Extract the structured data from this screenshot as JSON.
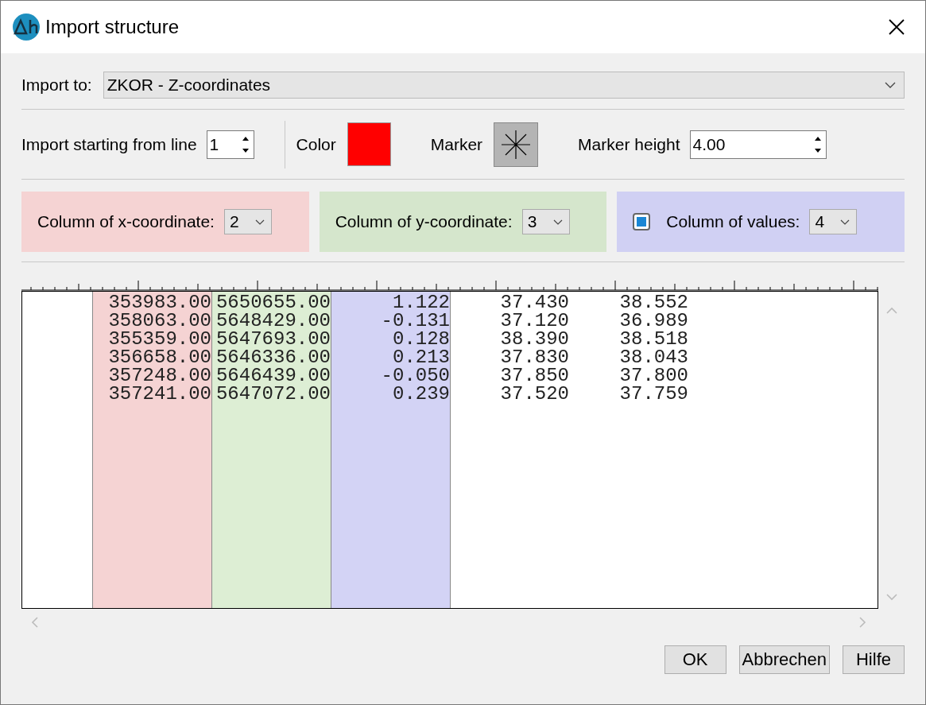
{
  "window": {
    "title": "Import structure"
  },
  "import_to": {
    "label": "Import to:",
    "value": "ZKOR - Z-coordinates"
  },
  "start_line": {
    "label": "Import starting from line",
    "value": "1"
  },
  "color": {
    "label": "Color",
    "color": "#ff0000"
  },
  "marker": {
    "label": "Marker"
  },
  "marker_height": {
    "label": "Marker height",
    "value": "4.00"
  },
  "column_selectors": [
    {
      "kind": "plain",
      "label": "Column of x-coordinate:",
      "value": "2",
      "color": "#f5d3d3"
    },
    {
      "kind": "plain",
      "label": "Column of y-coordinate:",
      "value": "3",
      "color": "#d5e6cc"
    },
    {
      "kind": "checkbox",
      "label": "Column of values:",
      "value": "4",
      "checked": true,
      "color": "#d0d0f3"
    }
  ],
  "preview": {
    "columns": [
      {
        "color": "#f5d3d3",
        "cells": [
          "353983.00",
          "358063.00",
          "355359.00",
          "356658.00",
          "357248.00",
          "357241.00"
        ]
      },
      {
        "color": "#ddeed4",
        "cells": [
          "5650655.00",
          "5648429.00",
          "5647693.00",
          "5646336.00",
          "5646439.00",
          "5647072.00"
        ]
      },
      {
        "color": "#d3d3f5",
        "cells": [
          "1.122",
          "-0.131",
          "0.128",
          "0.213",
          "-0.050",
          "0.239"
        ]
      },
      {
        "cells": [
          "37.430",
          "37.120",
          "38.390",
          "37.830",
          "37.850",
          "37.520"
        ]
      },
      {
        "cells": [
          "38.552",
          "36.989",
          "38.518",
          "38.043",
          "37.800",
          "37.759"
        ]
      }
    ]
  },
  "buttons": [
    "OK",
    "Abbrechen",
    "Hilfe"
  ]
}
